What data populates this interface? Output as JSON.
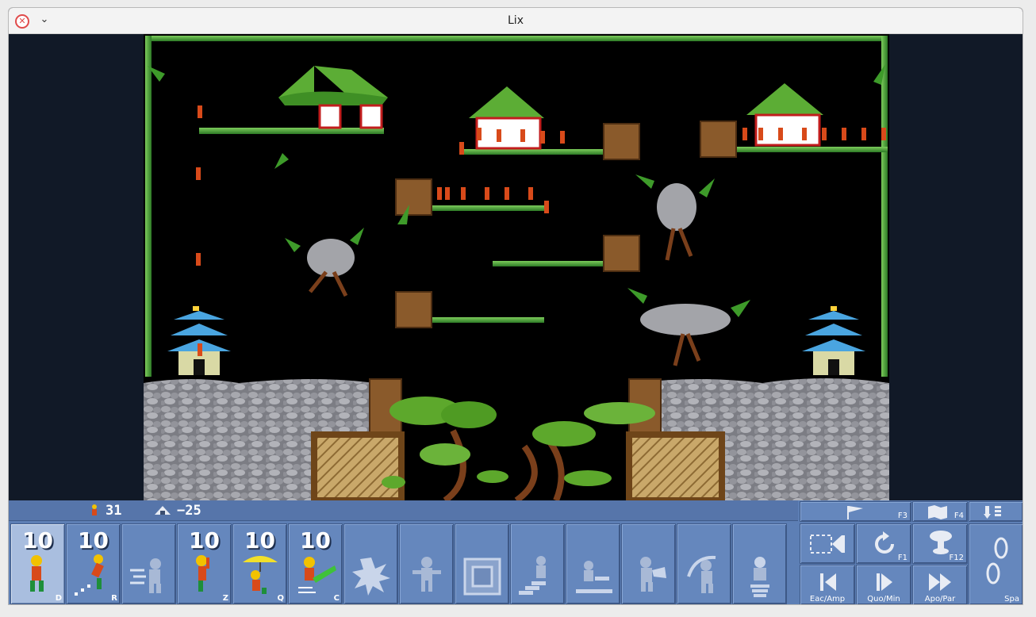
{
  "window": {
    "title": "Lix"
  },
  "stats": {
    "lix_out": "31",
    "saved": "−25"
  },
  "skills": [
    {
      "count": "10",
      "hotkey": "D",
      "icon": "walker-icon",
      "selected": true
    },
    {
      "count": "10",
      "hotkey": "R",
      "icon": "runner-icon"
    },
    {
      "count": "",
      "hotkey": "",
      "icon": "jumper-icon"
    },
    {
      "count": "10",
      "hotkey": "Z",
      "icon": "climber-icon"
    },
    {
      "count": "10",
      "hotkey": "Q",
      "icon": "floater-icon"
    },
    {
      "count": "10",
      "hotkey": "C",
      "icon": "batter-icon"
    },
    {
      "count": "",
      "hotkey": "",
      "icon": "exploder-icon"
    },
    {
      "count": "",
      "hotkey": "",
      "icon": "blocker-icon"
    },
    {
      "count": "",
      "hotkey": "",
      "icon": "cuber-icon"
    },
    {
      "count": "",
      "hotkey": "",
      "icon": "builder-icon"
    },
    {
      "count": "",
      "hotkey": "",
      "icon": "platformer-icon"
    },
    {
      "count": "",
      "hotkey": "",
      "icon": "basher-icon"
    },
    {
      "count": "",
      "hotkey": "",
      "icon": "miner-icon"
    },
    {
      "count": "",
      "hotkey": "",
      "icon": "digger-icon"
    }
  ],
  "controls": {
    "flag_hotkey": "F3",
    "map_hotkey": "F4",
    "spawn_hotkey": "",
    "rewind_hotkey": "",
    "restart_hotkey": "F1",
    "nuke_hotkey": "F12",
    "pause_label": "Spa",
    "slower_label": "Eac/Amp",
    "play_label": "Quo/Min",
    "faster_label": "Apo/Par"
  },
  "colors": {
    "hud": "#5d7fb5",
    "hud_selected": "#a9bedf",
    "bamboo": "#4fa23a",
    "rock": "#8d8e95",
    "wood": "#8a5a2b"
  }
}
